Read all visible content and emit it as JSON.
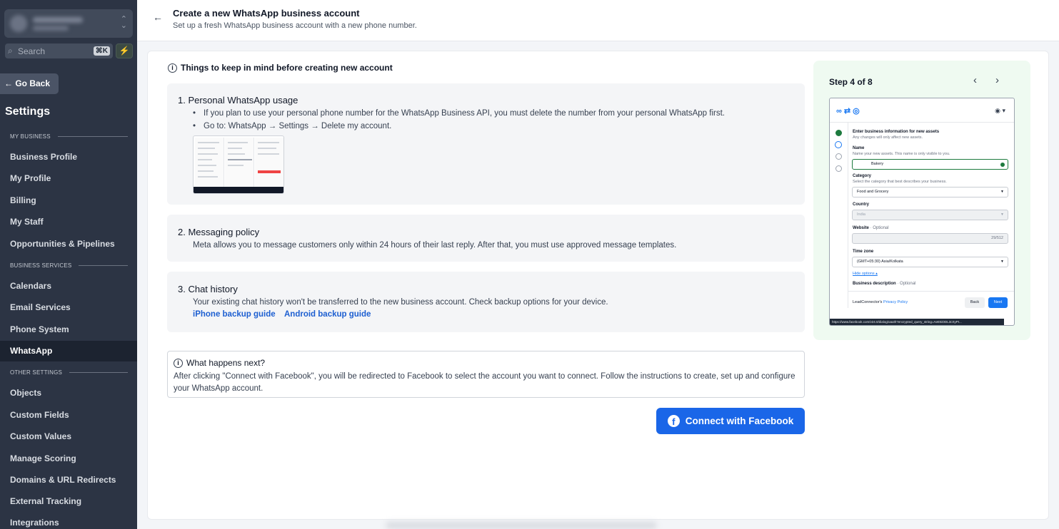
{
  "sidebar": {
    "search_placeholder": "Search",
    "search_shortcut": "⌘K",
    "go_back": "← Go Back",
    "title": "Settings",
    "sections": {
      "my_business": "MY BUSINESS",
      "business_services": "BUSINESS SERVICES",
      "other_settings": "OTHER SETTINGS"
    },
    "items": {
      "business_profile": "Business Profile",
      "my_profile": "My Profile",
      "billing": "Billing",
      "my_staff": "My Staff",
      "opportunities": "Opportunities & Pipelines",
      "calendars": "Calendars",
      "email_services": "Email Services",
      "phone_system": "Phone System",
      "whatsapp": "WhatsApp",
      "objects": "Objects",
      "custom_fields": "Custom Fields",
      "custom_values": "Custom Values",
      "manage_scoring": "Manage Scoring",
      "domains": "Domains & URL Redirects",
      "external_tracking": "External Tracking",
      "integrations": "Integrations"
    }
  },
  "header": {
    "title": "Create a new WhatsApp business account",
    "subtitle": "Set up a fresh WhatsApp business account with a new phone number."
  },
  "main": {
    "things_title": "Things to keep in mind before creating new account",
    "personal": {
      "title": "1. Personal WhatsApp usage",
      "bullet1": "If you plan to use your personal phone number for the WhatsApp Business API, you must delete the number from your personal WhatsApp first.",
      "bullet2": "Go to: WhatsApp → Settings → Delete my account."
    },
    "messaging": {
      "title": "2. Messaging policy",
      "text": "Meta allows you to message customers only within 24 hours of their last reply. After that, you must use approved message templates."
    },
    "chat": {
      "title": "3. Chat history",
      "text": "Your existing chat history won't be transferred to the new business account. Check backup options for your device.",
      "iphone_link": "iPhone backup guide",
      "android_link": "Android backup guide"
    },
    "next": {
      "title": "What happens next?",
      "text": "After clicking \"Connect with Facebook\", you will be redirected to Facebook to select the account you want to connect. Follow the instructions to create, set up and configure your WhatsApp account."
    },
    "connect_button": "Connect with Facebook"
  },
  "preview": {
    "step": "Step 4 of 8",
    "heading": "Enter business information for new assets",
    "heading_sub": "Any changes will only affect new assets.",
    "name_label": "Name",
    "name_hint": "Name your new assets. This name is only visible to you.",
    "name_value": "Bakery",
    "category_label": "Category",
    "category_hint": "Select the category that best describes your business.",
    "category_value": "Food and Grocery",
    "country_label": "Country",
    "country_value": "India",
    "website_label": "Website",
    "website_optional": "· Optional",
    "website_count": "29/512",
    "timezone_label": "Time zone",
    "timezone_value": "(GMT+05:30) Asia/Kolkata",
    "hide_options": "Hide options ▴",
    "desc_label": "Business description",
    "desc_optional": "· Optional",
    "footer_text": "LeadConnector's",
    "privacy": "Privacy Policy",
    "back_btn": "Back",
    "next_btn": "Next",
    "url": "https://www.facebook.com/v24.0/dialog/oauth?encrypted_query_string=AeE5iODL3cXyPI..."
  }
}
